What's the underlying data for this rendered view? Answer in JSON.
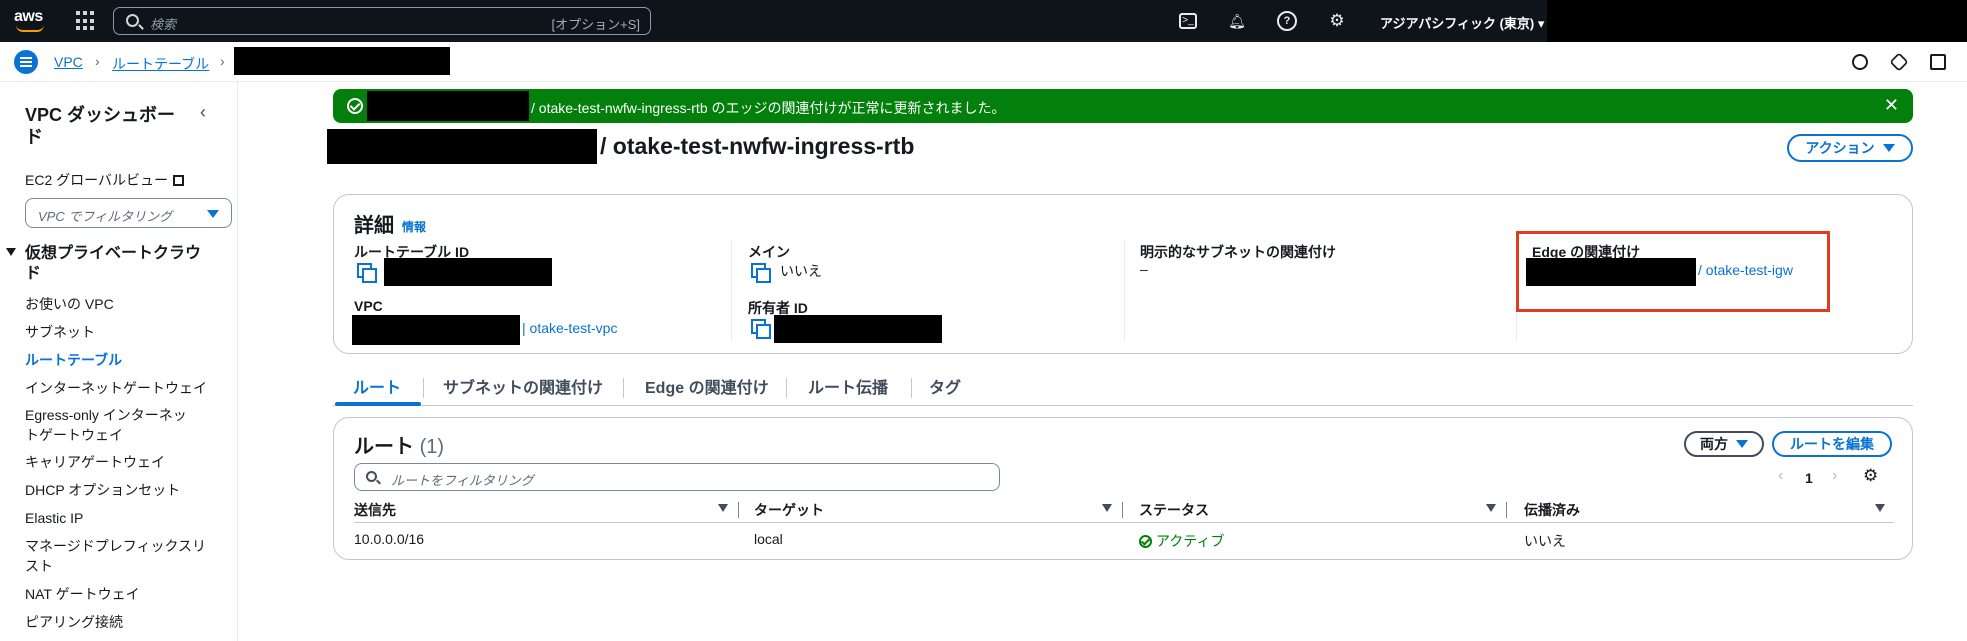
{
  "topnav": {
    "logo": "aws",
    "search_placeholder": "検索",
    "search_shortcut": "[オプション+S]",
    "region": "アジアパシフィック (東京) ▾",
    "icons": [
      "apps-grid-icon",
      "cloudshell-icon",
      "bell-icon",
      "help-icon",
      "gear-icon"
    ]
  },
  "breadcrumb": {
    "items": [
      "VPC",
      "ルートテーブル"
    ],
    "separator": "›"
  },
  "sidebar": {
    "title": "VPC ダッシュボード",
    "collapse": "‹",
    "ec2_global_view": "EC2 グローバルビュー",
    "vpc_filter": "VPC でフィルタリング",
    "section_title": "仮想プライベートクラウド",
    "items": [
      "お使いの VPC",
      "サブネット",
      "ルートテーブル",
      "インターネットゲートウェイ",
      "Egress-only インターネットゲートウェイ",
      "キャリアゲートウェイ",
      "DHCP オプションセット",
      "Elastic IP",
      "マネージドプレフィックスリスト",
      "NAT ゲートウェイ",
      "ピアリング接続"
    ],
    "active_item": "ルートテーブル"
  },
  "banner": {
    "message": "/ otake-test-nwfw-ingress-rtb のエッジの関連付けが正常に更新されました。",
    "close": "✕",
    "color": "#037f0c"
  },
  "page": {
    "title": "/ otake-test-nwfw-ingress-rtb",
    "action_button": "アクション"
  },
  "details": {
    "heading": "詳細",
    "info": "情報",
    "route_table_id_label": "ルートテーブル ID",
    "main_label": "メイン",
    "main_value": "いいえ",
    "explicit_subnet_label": "明示的なサブネットの関連付け",
    "explicit_subnet_value": "–",
    "edge_label": "Edge の関連付け",
    "edge_value": "/ otake-test-igw",
    "vpc_label": "VPC",
    "vpc_value": "| otake-test-vpc",
    "owner_label": "所有者 ID"
  },
  "tabs": [
    "ルート",
    "サブネットの関連付け",
    "Edge の関連付け",
    "ルート伝播",
    "タグ"
  ],
  "routes": {
    "heading": "ルート",
    "count": "(1)",
    "both_button": "両方",
    "edit_button": "ルートを編集",
    "filter_placeholder": "ルートをフィルタリング",
    "page": "1",
    "prev": "‹",
    "next": "›",
    "columns": [
      "送信先",
      "ターゲット",
      "ステータス",
      "伝播済み"
    ],
    "rows": [
      {
        "destination": "10.0.0.0/16",
        "target": "local",
        "status": "アクティブ",
        "propagated": "いいえ"
      }
    ]
  },
  "colors": {
    "accent": "#0972d3",
    "success": "#037f0c",
    "highlight": "#e03c1f",
    "nav_bg": "#0f141a"
  }
}
